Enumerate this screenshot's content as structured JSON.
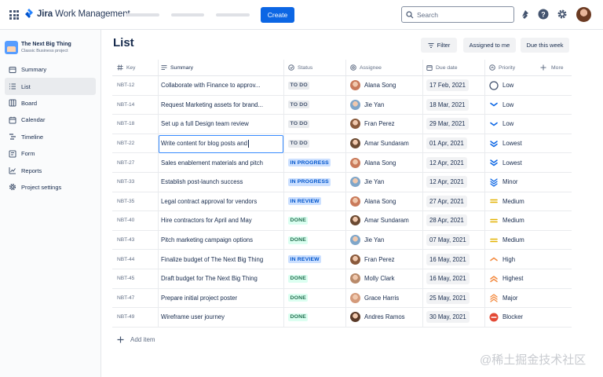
{
  "topbar": {
    "app_name_bold": "Jira",
    "app_name_rest": " Work Management",
    "create_label": "Create",
    "search_placeholder": "Search"
  },
  "sidebar": {
    "project_name": "The Next Big Thing",
    "project_type": "Classic Business project",
    "items": [
      {
        "label": "Summary",
        "icon": "summary-icon",
        "active": false
      },
      {
        "label": "List",
        "icon": "list-icon",
        "active": true
      },
      {
        "label": "Board",
        "icon": "board-icon",
        "active": false
      },
      {
        "label": "Calendar",
        "icon": "calendar-icon",
        "active": false
      },
      {
        "label": "Timeline",
        "icon": "timeline-icon",
        "active": false
      },
      {
        "label": "Form",
        "icon": "form-icon",
        "active": false
      },
      {
        "label": "Reports",
        "icon": "reports-icon",
        "active": false
      },
      {
        "label": "Project settings",
        "icon": "gear-icon",
        "active": false
      }
    ]
  },
  "main": {
    "title": "List",
    "filter_label": "Filter",
    "assigned_label": "Assigned to me",
    "due_week_label": "Due this week",
    "add_item_label": "Add item"
  },
  "table": {
    "headers": {
      "key": "Key",
      "summary": "Summary",
      "status": "Status",
      "assignee": "Assignee",
      "due_date": "Due date",
      "priority": "Priority",
      "more": "More"
    },
    "rows": [
      {
        "key": "NBT-12",
        "summary": "Collaborate with Finance to approv...",
        "status": "TO DO",
        "status_type": "todo",
        "assignee": "Alana Song",
        "avatar": "#c97a5a",
        "due": "17 Feb, 2021",
        "priority": "Low",
        "priority_icon": "circle"
      },
      {
        "key": "NBT-14",
        "summary": "Request Marketing assets for brand...",
        "status": "TO DO",
        "status_type": "todo",
        "assignee": "Jie Yan",
        "avatar": "#7fa6c9",
        "due": "18 Mar, 2021",
        "priority": "Low",
        "priority_icon": "low"
      },
      {
        "key": "NBT-18",
        "summary": "Set up a full Design team review",
        "status": "TO DO",
        "status_type": "todo",
        "assignee": "Fran Perez",
        "avatar": "#8a5a3c",
        "due": "29 Mar, 2021",
        "priority": "Low",
        "priority_icon": "low"
      },
      {
        "key": "NBT-22",
        "summary": "Write content for blog posts and",
        "status": "TO DO",
        "status_type": "todo",
        "assignee": "Amar Sundaram",
        "avatar": "#6b4a32",
        "due": "01 Apr, 2021",
        "priority": "Lowest",
        "priority_icon": "lowest",
        "editing": true
      },
      {
        "key": "NBT-27",
        "summary": "Sales enablement materials and pitch",
        "status": "IN PROGRESS",
        "status_type": "prog",
        "assignee": "Alana Song",
        "avatar": "#c97a5a",
        "due": "12 Apr, 2021",
        "priority": "Lowest",
        "priority_icon": "lowest"
      },
      {
        "key": "NBT-33",
        "summary": "Establish post-launch success",
        "status": "IN PROGRESS",
        "status_type": "prog",
        "assignee": "Jie Yan",
        "avatar": "#7fa6c9",
        "due": "12 Apr, 2021",
        "priority": "Minor",
        "priority_icon": "minor"
      },
      {
        "key": "NBT-35",
        "summary": "Legal contract approval for vendors",
        "status": "IN REVIEW",
        "status_type": "prog",
        "assignee": "Alana Song",
        "avatar": "#c97a5a",
        "due": "27 Apr, 2021",
        "priority": "Medium",
        "priority_icon": "medium"
      },
      {
        "key": "NBT-40",
        "summary": "Hire contractors for April and May",
        "status": "DONE",
        "status_type": "done",
        "assignee": "Amar Sundaram",
        "avatar": "#6b4a32",
        "due": "28 Apr, 2021",
        "priority": "Medium",
        "priority_icon": "medium"
      },
      {
        "key": "NBT-43",
        "summary": "Pitch marketing campaign options",
        "status": "DONE",
        "status_type": "done",
        "assignee": "Jie Yan",
        "avatar": "#7fa6c9",
        "due": "07 May, 2021",
        "priority": "Medium",
        "priority_icon": "medium"
      },
      {
        "key": "NBT-44",
        "summary": "Finalize budget of The Next Big Thing",
        "status": "IN REVIEW",
        "status_type": "prog",
        "assignee": "Fran Perez",
        "avatar": "#8a5a3c",
        "due": "16 May, 2021",
        "priority": "High",
        "priority_icon": "high"
      },
      {
        "key": "NBT-45",
        "summary": "Draft budget for The Next Big Thing",
        "status": "DONE",
        "status_type": "done",
        "assignee": "Molly Clark",
        "avatar": "#b98a6a",
        "due": "16 May, 2021",
        "priority": "Highest",
        "priority_icon": "highest"
      },
      {
        "key": "NBT-47",
        "summary": "Prepare initial project poster",
        "status": "DONE",
        "status_type": "done",
        "assignee": "Grace Harris",
        "avatar": "#d49a7a",
        "due": "25 May, 2021",
        "priority": "Major",
        "priority_icon": "major"
      },
      {
        "key": "NBT-49",
        "summary": "Wireframe user journey",
        "status": "DONE",
        "status_type": "done",
        "assignee": "Andres Ramos",
        "avatar": "#5a3a28",
        "due": "30 May, 2021",
        "priority": "Blocker",
        "priority_icon": "blocker"
      }
    ]
  },
  "watermark": "@稀土掘金技术社区",
  "colors": {
    "accent": "#0c66e4",
    "todo_bg": "#e9ebee",
    "progress_bg": "#cce0ff",
    "done_bg": "#dcfff1",
    "priority_low": "#0c66e4",
    "priority_medium": "#e2b203",
    "priority_high": "#f38a3f",
    "priority_blocker": "#e34935"
  }
}
